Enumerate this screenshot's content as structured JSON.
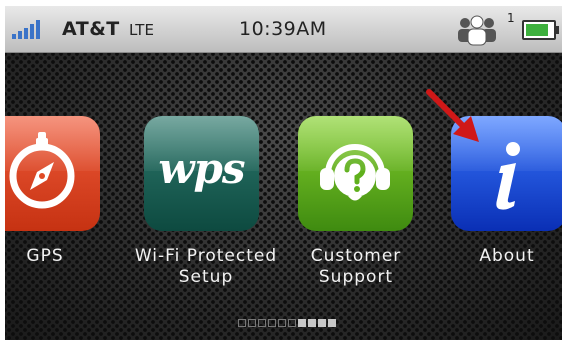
{
  "status_bar": {
    "carrier": "AT&T",
    "network": "LTE",
    "time": "10:39AM",
    "connected_users": "1",
    "signal_icon": "signal-bars-icon",
    "users_icon": "users-icon",
    "battery_icon": "battery-icon",
    "battery_level": 0.85
  },
  "apps": [
    {
      "label": "GPS",
      "icon": "compass-icon",
      "color": "#e04a25"
    },
    {
      "label": "Wi-Fi Protected Setup",
      "icon_text": "wps",
      "color": "#1d5e53"
    },
    {
      "label": "Customer Support",
      "icon": "headset-question-icon",
      "color": "#5fb01c"
    },
    {
      "label": "About",
      "icon": "info-icon",
      "color": "#1f56e6"
    }
  ],
  "pager": {
    "pages": 10,
    "active_pages": [
      7,
      8,
      9,
      10
    ]
  },
  "annotation": {
    "arrow_color": "#d01818",
    "arrow_icon": "red-arrow-icon"
  }
}
